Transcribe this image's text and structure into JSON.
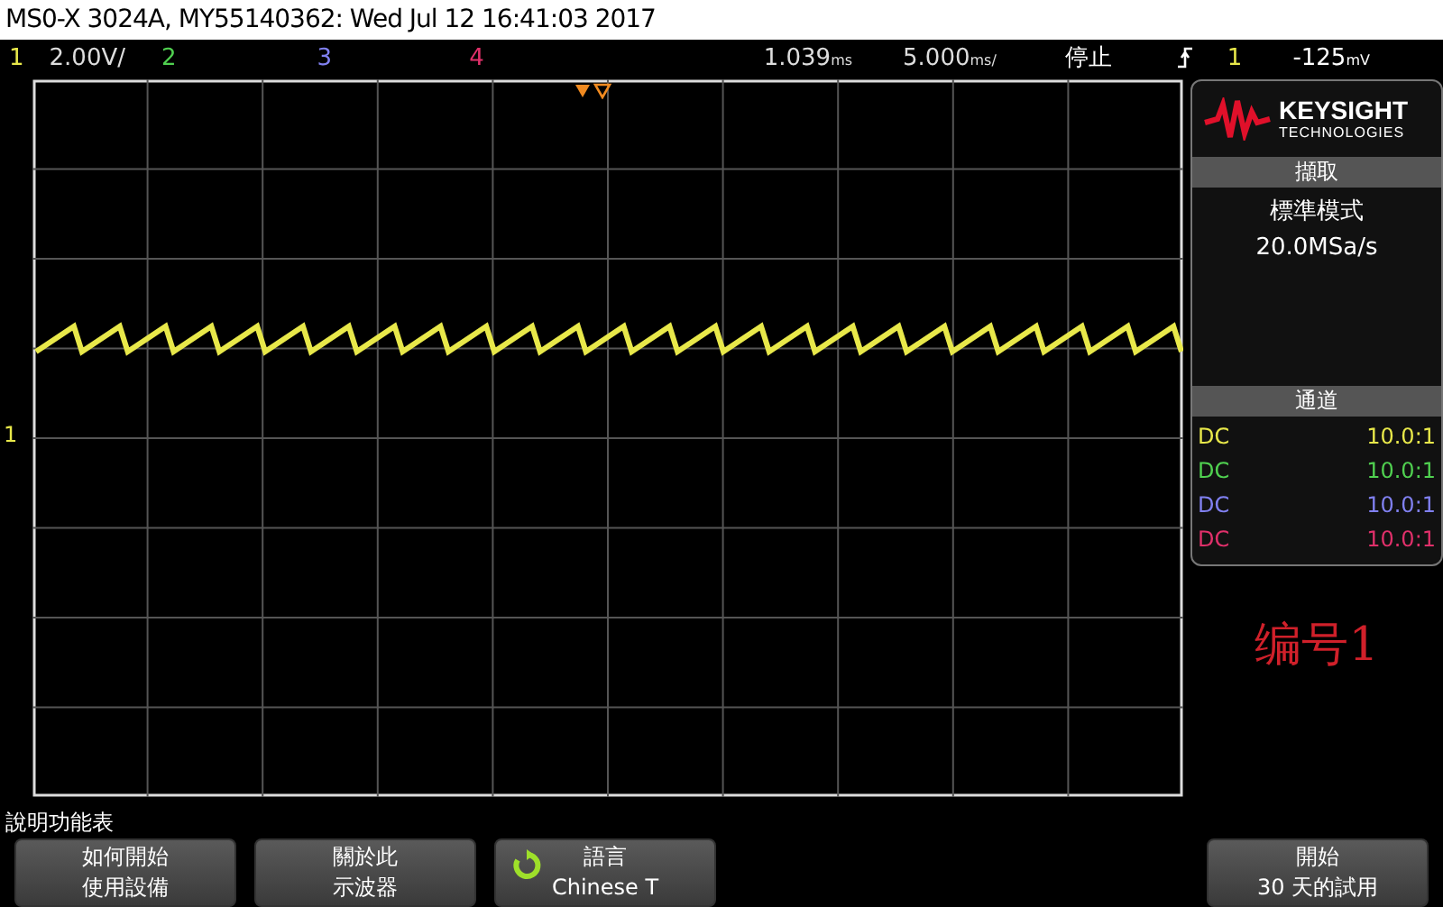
{
  "title_bar": {
    "text": "MS0-X 3024A, MY55140362: Wed Jul 12 16:41:03 2017"
  },
  "channels": [
    {
      "number": "1",
      "scale": "2.00V/",
      "color": "#e8e84a"
    },
    {
      "number": "2",
      "color": "#50d050"
    },
    {
      "number": "3",
      "color": "#8080f0"
    },
    {
      "number": "4",
      "color": "#e0306a"
    }
  ],
  "timebase": {
    "delay": "1.039",
    "delay_unit": "ms",
    "scale": "5.000",
    "scale_unit": "ms/"
  },
  "run_state": "停止",
  "trigger": {
    "source": "1",
    "level": "-125",
    "level_unit": "mV"
  },
  "ground_marker": "1",
  "logo": {
    "name": "KEYSIGHT",
    "sub": "TECHNOLOGIES"
  },
  "acquisition": {
    "header": "擷取",
    "mode": "標準模式",
    "sample_rate": "20.0MSa/s"
  },
  "channel_panel": {
    "header": "通道",
    "rows": [
      {
        "coupling": "DC",
        "probe": "10.0:1",
        "color": "#e8e84a"
      },
      {
        "coupling": "DC",
        "probe": "10.0:1",
        "color": "#50d050"
      },
      {
        "coupling": "DC",
        "probe": "10.0:1",
        "color": "#8080f0"
      },
      {
        "coupling": "DC",
        "probe": "10.0:1",
        "color": "#e0306a"
      }
    ]
  },
  "annotation": "编号1",
  "menu_title": "說明功能表",
  "softkeys": [
    {
      "kind": "plain",
      "lines": [
        "如何開始",
        "使用設備"
      ]
    },
    {
      "kind": "plain",
      "lines": [
        "關於此",
        "示波器"
      ]
    },
    {
      "kind": "cycle",
      "lines": [
        "語言",
        "Chinese T"
      ]
    },
    {
      "kind": "plain",
      "lines": [
        "開始",
        "30 天的試用"
      ]
    }
  ]
}
